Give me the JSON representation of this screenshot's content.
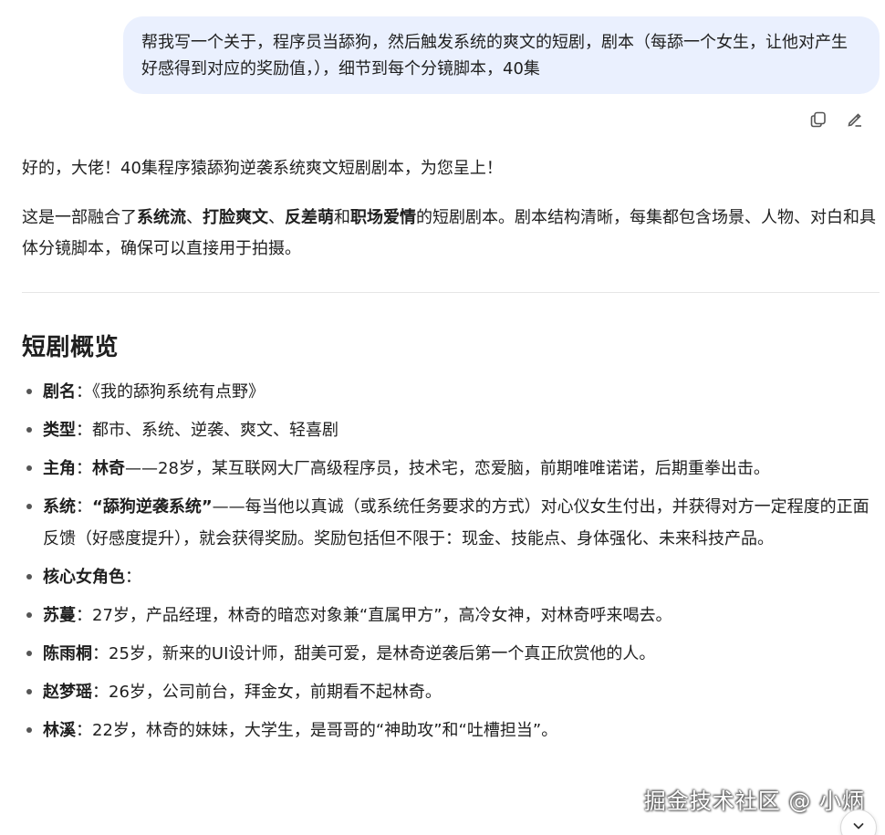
{
  "user_message": {
    "text": "帮我写一个关于，程序员当舔狗，然后触发系统的爽文的短剧，剧本（每舔一个女生，让他对产生好感得到对应的奖励值，），细节到每个分镜脚本，40集"
  },
  "message_actions": {
    "copy_icon": "copy-icon",
    "edit_icon": "edit-icon"
  },
  "answer": {
    "intro": "好的，大佬！40集程序猿舔狗逆袭系统爽文短剧剧本，为您呈上！",
    "desc": {
      "prefix": "这是一部融合了",
      "tag1": "系统流",
      "sep1": "、",
      "tag2": "打脸爽文",
      "sep2": "、",
      "tag3": "反差萌",
      "and": "和",
      "tag4": "职场爱情",
      "suffix": "的短剧剧本。剧本结构清晰，每集都包含场景、人物、对白和具体分镜脚本，确保可以直接用于拍摄。"
    },
    "section_title": "短剧概览",
    "overview": {
      "title_label": "剧名",
      "title_value": "：《我的舔狗系统有点野》",
      "genre_label": "类型",
      "genre_value": "：都市、系统、逆袭、爽文、轻喜剧",
      "lead_label": "主角",
      "lead_colon": "：",
      "lead_name": "林奇",
      "lead_value": "——28岁，某互联网大厂高级程序员，技术宅，恋爱脑，前期唯唯诺诺，后期重拳出击。",
      "system_label": "系统",
      "system_colon": "：",
      "system_name": "“舔狗逆袭系统”",
      "system_value": "——每当他以真诚（或系统任务要求的方式）对心仪女生付出，并获得对方一定程度的正面反馈（好感度提升），就会获得奖励。奖励包括但不限于：现金、技能点、身体强化、未来科技产品。",
      "female_label": "核心女角色",
      "female_colon": "：",
      "c1_name": "苏蔓",
      "c1_desc": "：27岁，产品经理，林奇的暗恋对象兼“直属甲方”，高冷女神，对林奇呼来喝去。",
      "c2_name": "陈雨桐",
      "c2_desc": "：25岁，新来的UI设计师，甜美可爱，是林奇逆袭后第一个真正欣赏他的人。",
      "c3_name": "赵梦瑶",
      "c3_desc": "：26岁，公司前台，拜金女，前期看不起林奇。",
      "c4_name": "林溪",
      "c4_desc": "：22岁，林奇的妹妹，大学生，是哥哥的“神助攻”和“吐槽担当”。"
    }
  },
  "watermark": "掘金技术社区 @ 小炳",
  "scroll_button_icon": "chevron-down-icon"
}
